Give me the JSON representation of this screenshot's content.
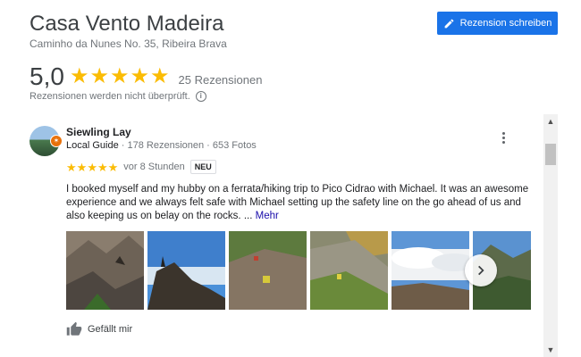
{
  "place": {
    "name": "Casa Vento Madeira",
    "address": "Caminho da Nunes No. 35, Ribeira Brava"
  },
  "header": {
    "write_review_label": "Rezension schreiben",
    "write_review_icon": "pencil-icon",
    "accent_color": "#1a73e8"
  },
  "summary": {
    "rating": "5,0",
    "stars": 5,
    "review_count": "25 Rezensionen",
    "disclaimer": "Rezensionen werden nicht überprüft.",
    "info_icon": "info-icon"
  },
  "review": {
    "author": "Siewling Lay",
    "author_badge": "Local Guide",
    "author_stats": " · 178 Rezensionen · 653 Fotos",
    "stars": 5,
    "date": "vor 8 Stunden",
    "new_badge": "NEU",
    "text": "I booked myself and my hubby on a ferrata/hiking trip to Pico Cidrao with Michael. It was an awesome experience and we always felt safe with Michael setting up the safety line on the go ahead of us and also keeping us on belay on the rocks. ...",
    "more_link": "Mehr",
    "photo_count_visible": 6,
    "like_label": "Gefällt mir"
  },
  "colors": {
    "star": "#fbbc04",
    "link": "#1a0dab"
  }
}
